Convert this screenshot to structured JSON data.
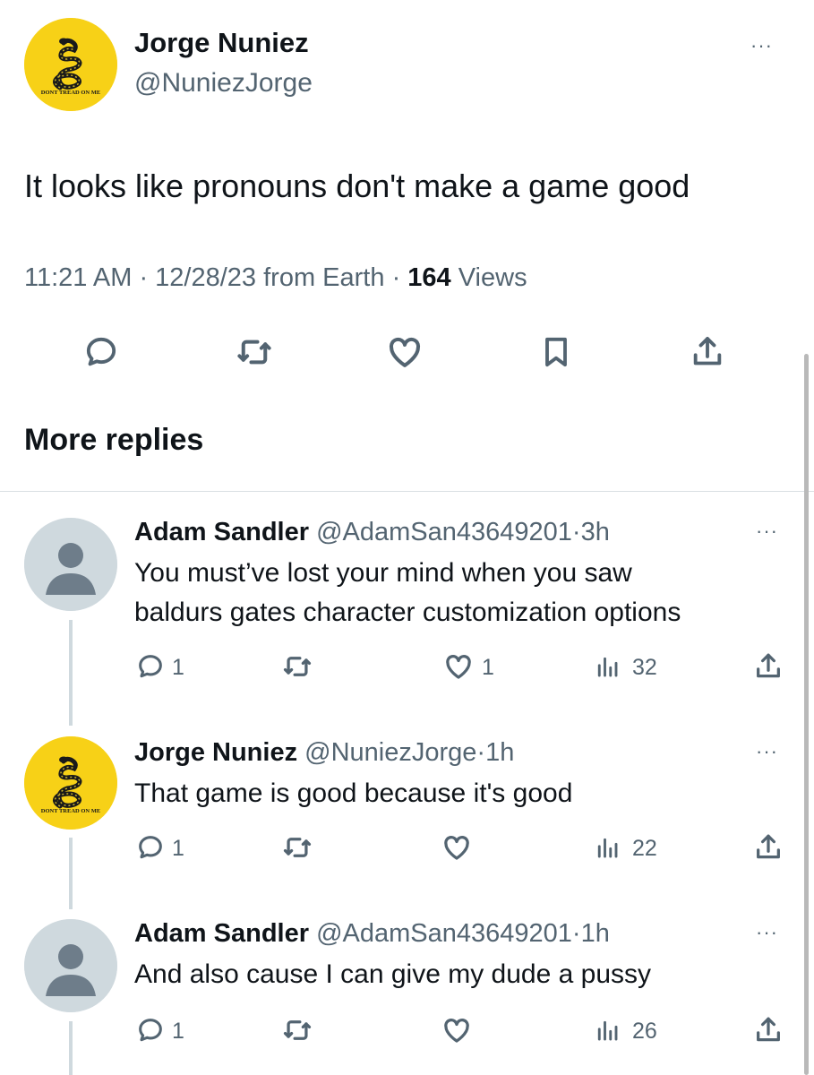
{
  "main_tweet": {
    "author_name": "Jorge Nuniez",
    "author_handle": "@NuniezJorge",
    "avatar_caption": "DONT TREAD ON ME",
    "text": "It looks like pronouns don't make a game good",
    "time": "11:21 AM",
    "date": "12/28/23 from Earth",
    "views_count": "164",
    "views_label": "Views",
    "more_glyph": "···"
  },
  "section_title": "More replies",
  "replies": [
    {
      "name": "Adam Sandler",
      "handle": "@AdamSan43649201",
      "time": "3h",
      "separator": "·",
      "text_lines": [
        "You must’ve lost your mind when you saw",
        "baldurs gates character customization options"
      ],
      "replies_count": "1",
      "likes_count": "1",
      "views_count": "32",
      "avatar": "default-avatar"
    },
    {
      "name": "Jorge Nuniez",
      "handle": "@NuniezJorge",
      "time": "1h",
      "separator": "·",
      "text_lines": [
        "That game is good because it's good"
      ],
      "replies_count": "1",
      "likes_count": "",
      "views_count": "22",
      "avatar": "snake-flag-avatar",
      "avatar_caption": "DONT TREAD ON ME"
    },
    {
      "name": "Adam Sandler",
      "handle": "@AdamSan43649201",
      "time": "1h",
      "separator": "·",
      "text_lines": [
        "And also cause I can give my dude a pussy"
      ],
      "replies_count": "1",
      "likes_count": "",
      "views_count": "26",
      "avatar": "default-avatar"
    }
  ],
  "colors": {
    "text": "#0f1419",
    "secondary": "#536471",
    "flag_yellow": "#f7d117",
    "default_avatar": "#cfd9de"
  }
}
